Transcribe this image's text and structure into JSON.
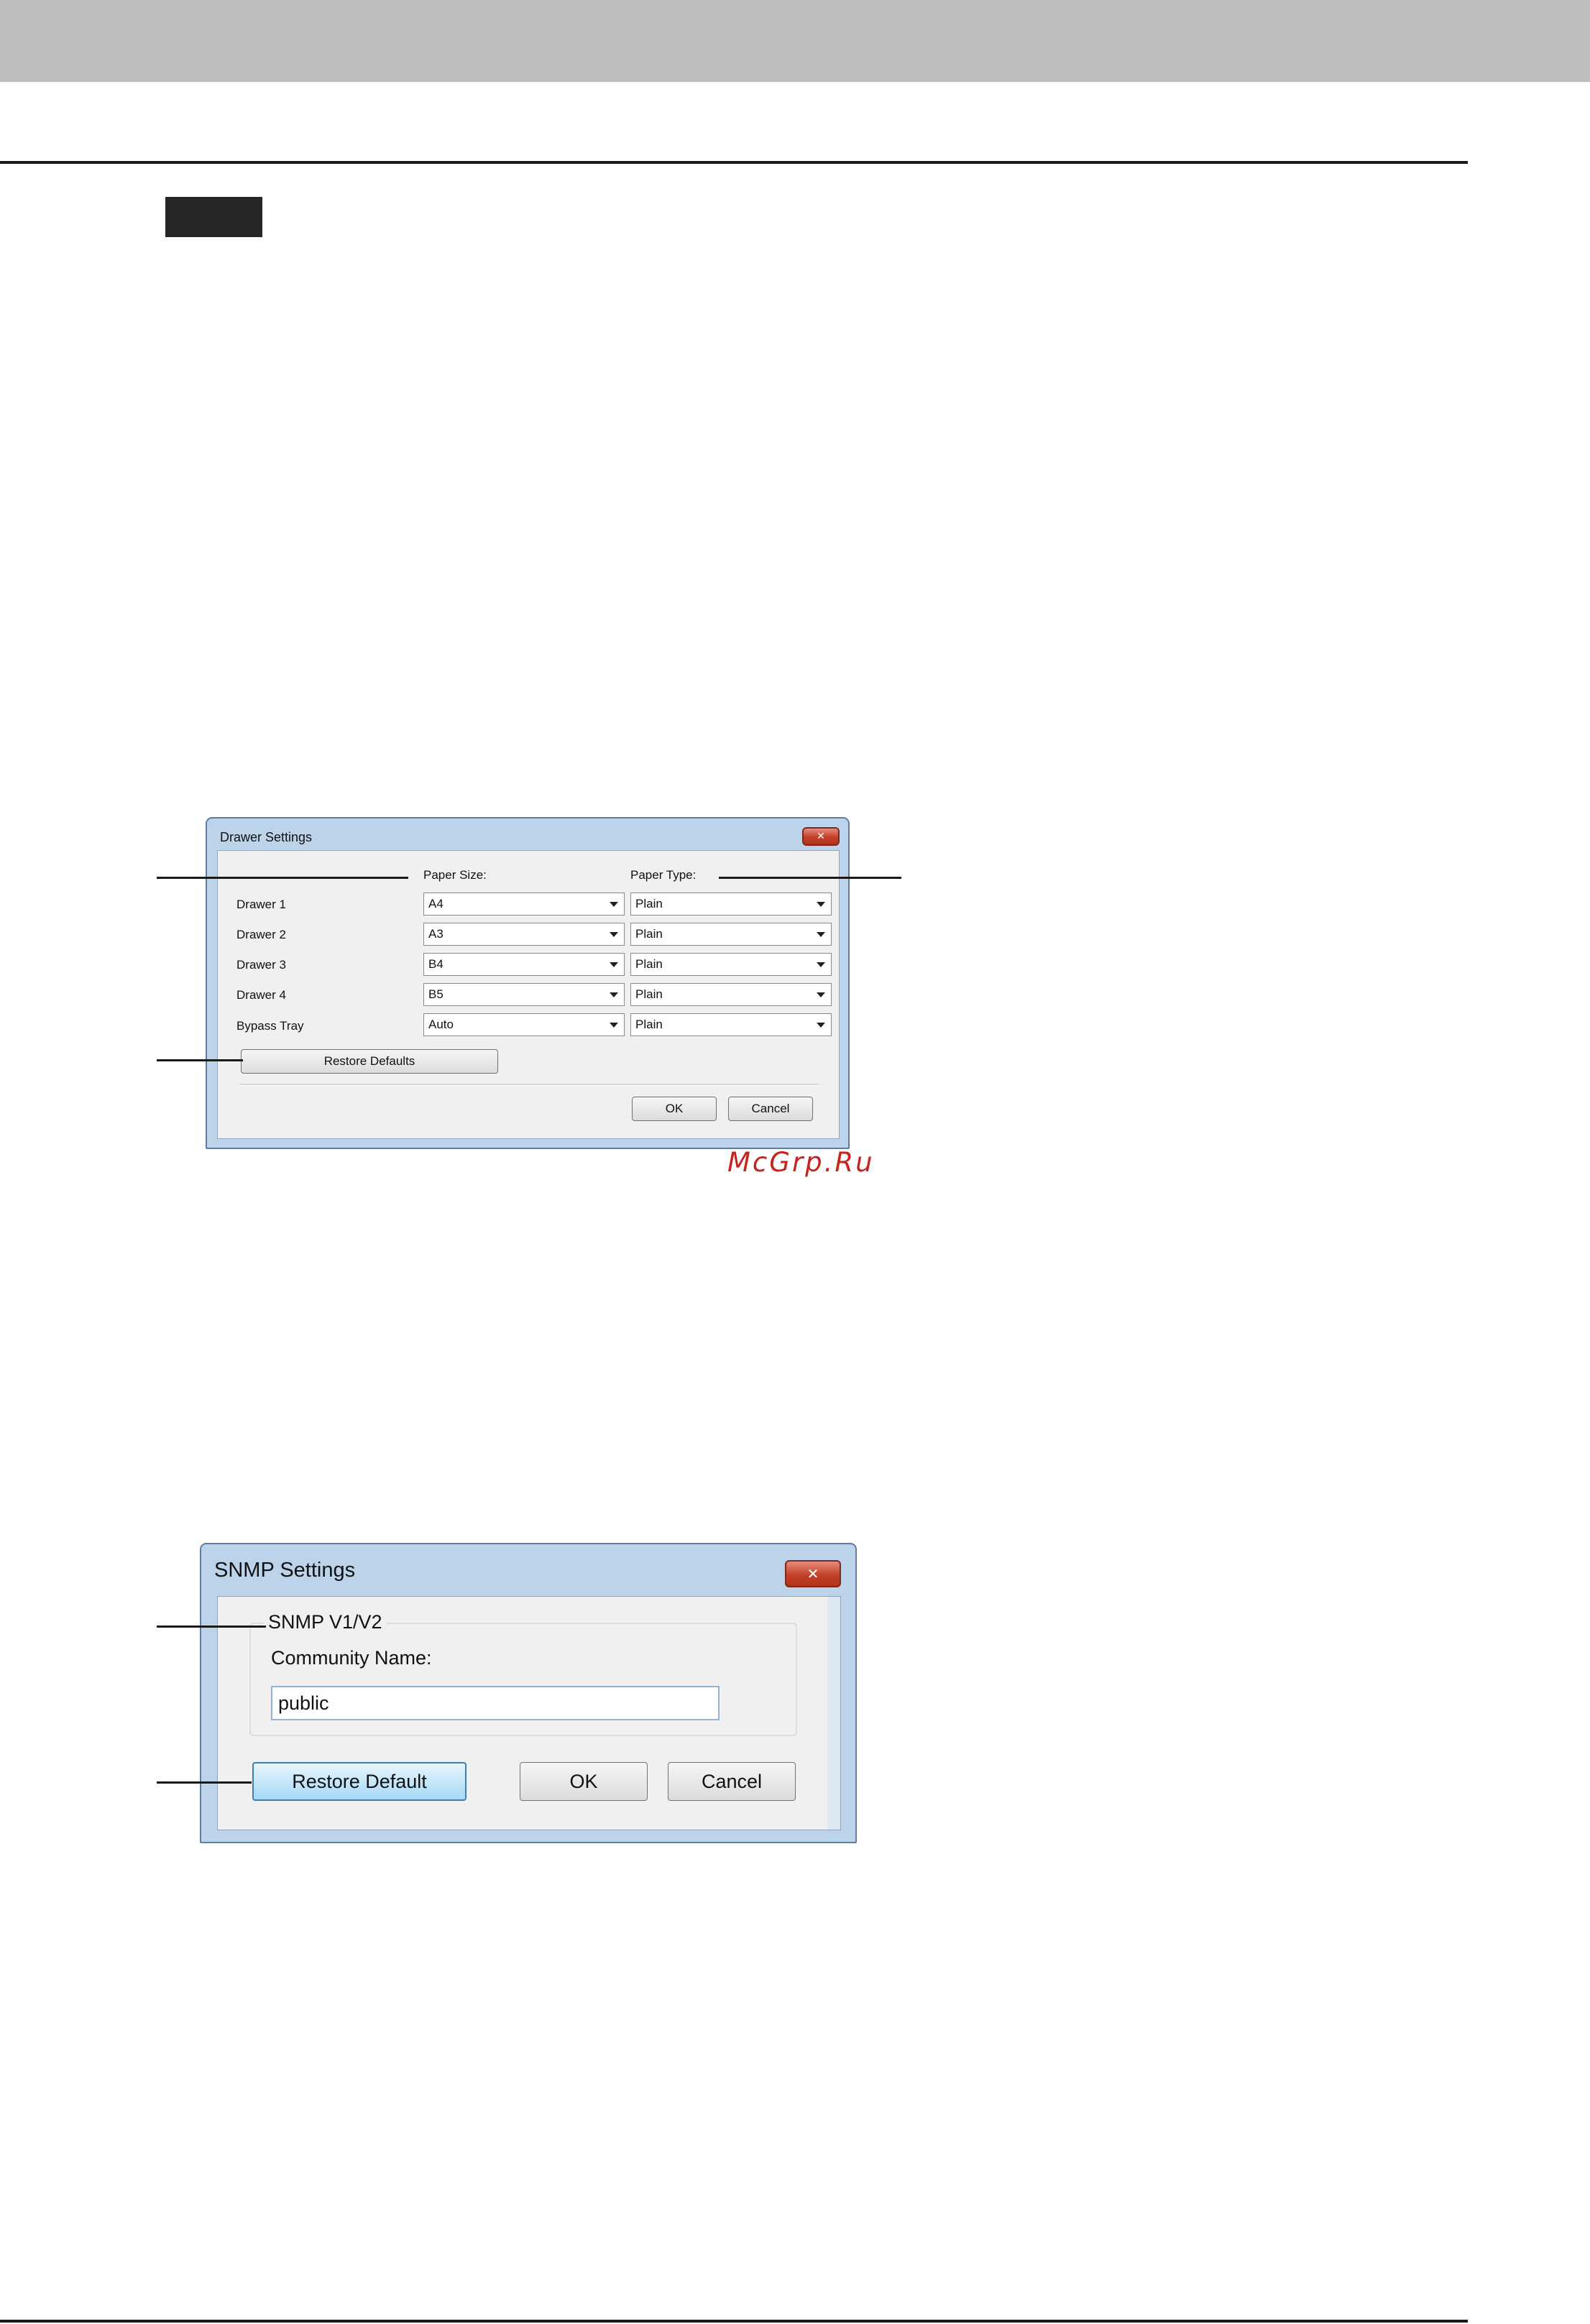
{
  "drawer_dialog": {
    "title": "Drawer Settings",
    "close_symbol": "✕",
    "paper_size_header": "Paper Size:",
    "paper_type_header": "Paper Type:",
    "rows": [
      {
        "label": "Drawer 1",
        "size": "A4",
        "type": "Plain"
      },
      {
        "label": "Drawer 2",
        "size": "A3",
        "type": "Plain"
      },
      {
        "label": "Drawer 3",
        "size": "B4",
        "type": "Plain"
      },
      {
        "label": "Drawer 4",
        "size": "B5",
        "type": "Plain"
      },
      {
        "label": "Bypass Tray",
        "size": "Auto",
        "type": "Plain"
      }
    ],
    "restore_label": "Restore Defaults",
    "ok_label": "OK",
    "cancel_label": "Cancel"
  },
  "snmp_dialog": {
    "title": "SNMP Settings",
    "close_symbol": "✕",
    "group_label": "SNMP V1/V2",
    "community_label": "Community Name:",
    "community_value": "public",
    "restore_label": "Restore Default",
    "ok_label": "OK",
    "cancel_label": "Cancel"
  },
  "watermark": "McGrp.Ru",
  "colors": {
    "title_bar": "#bcd3ea",
    "close_button": "#c3412b",
    "focused_button": "#bfe4f9",
    "watermark": "#c8231f"
  }
}
